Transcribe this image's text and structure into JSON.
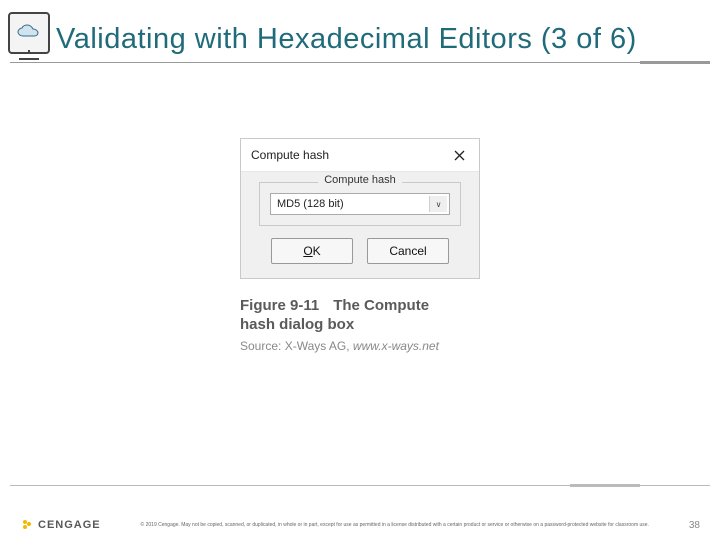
{
  "header": {
    "title": "Validating with Hexadecimal Editors (3 of 6)"
  },
  "dialog": {
    "title": "Compute hash",
    "fieldset_label": "Compute hash",
    "selected_value": "MD5 (128 bit)",
    "ok_label": "OK",
    "cancel_label": "Cancel"
  },
  "figure": {
    "number": "Figure 9-11",
    "desc1": "The Compute",
    "desc2": "hash dialog box",
    "source_label": "Source: X-Ways AG, ",
    "source_url": "www.x-ways.net"
  },
  "footer": {
    "brand": "CENGAGE",
    "copyright": "© 2019 Cengage. May not be copied, scanned, or duplicated, in whole or in part, except for use as permitted in a license distributed with a certain product or service or otherwise on a password-protected website for classroom use.",
    "page": "38"
  }
}
